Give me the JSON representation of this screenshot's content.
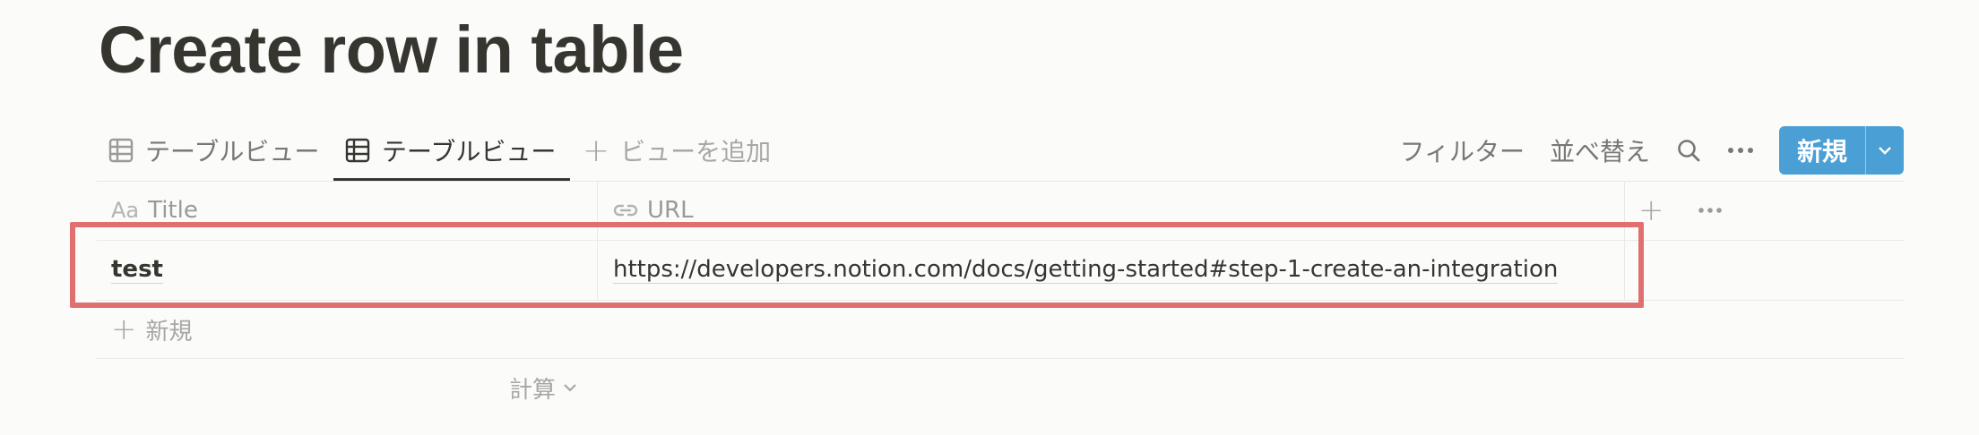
{
  "page": {
    "title": "Create row in table"
  },
  "views": {
    "tabs": [
      {
        "label": "テーブルビュー",
        "active": false
      },
      {
        "label": "テーブルビュー",
        "active": true
      }
    ],
    "add_view_label": "ビューを追加"
  },
  "toolbar": {
    "filter_label": "フィルター",
    "sort_label": "並べ替え",
    "new_label": "新規"
  },
  "table": {
    "columns": [
      {
        "label": "Title",
        "icon": "text-property-icon"
      },
      {
        "label": "URL",
        "icon": "link-property-icon"
      }
    ],
    "rows": [
      {
        "title": "test",
        "url": "https://developers.notion.com/docs/getting-started#step-1-create-an-integration"
      }
    ],
    "add_row_label": "新規",
    "calculate_label": "計算"
  },
  "colors": {
    "accent": "#4a9fd5",
    "highlight": "#e07070",
    "text": "#37352f",
    "muted": "#9b9a97"
  }
}
